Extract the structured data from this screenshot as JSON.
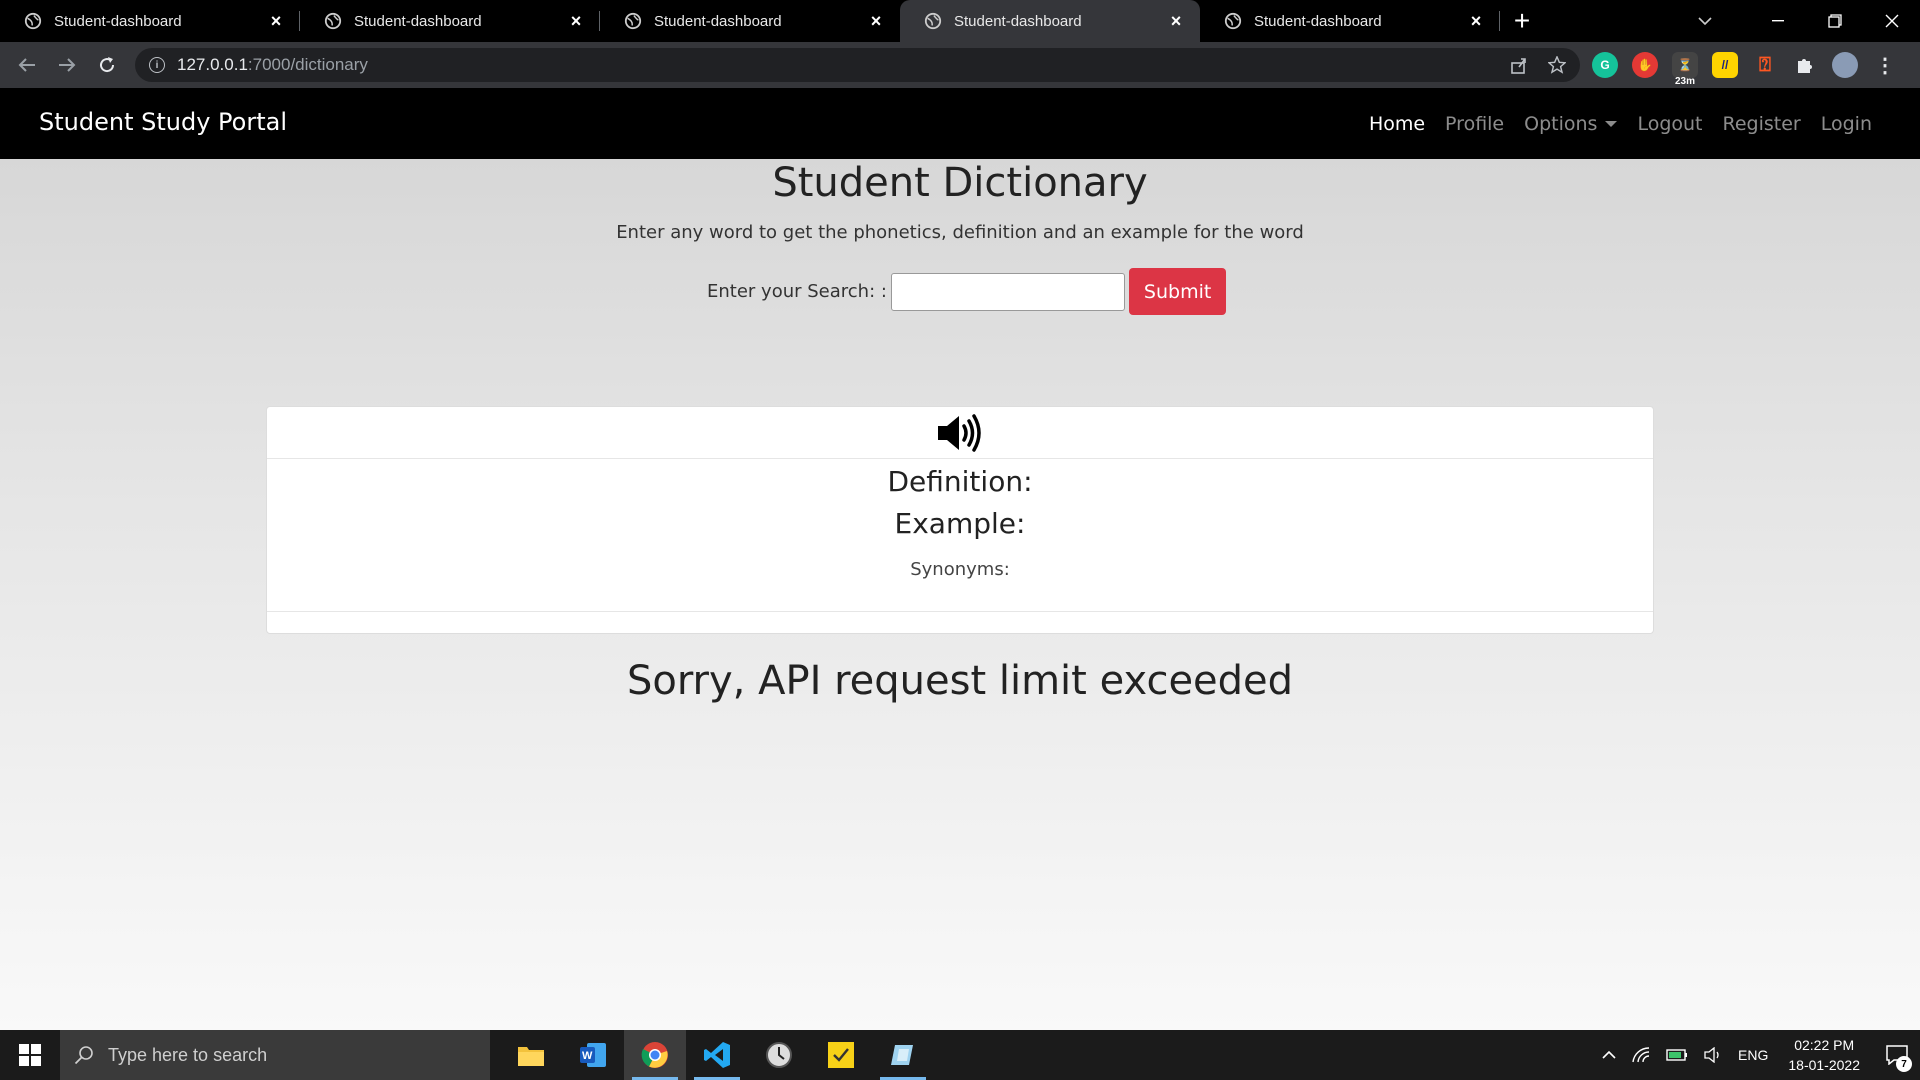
{
  "browser": {
    "tabs": [
      {
        "title": "Student-dashboard",
        "active": false
      },
      {
        "title": "Student-dashboard",
        "active": false
      },
      {
        "title": "Student-dashboard",
        "active": false
      },
      {
        "title": "Student-dashboard",
        "active": true
      },
      {
        "title": "Student-dashboard",
        "active": false
      }
    ],
    "url_host": "127.0.0.1",
    "url_path": ":7000/dictionary",
    "extension_badge": "23m"
  },
  "navbar": {
    "brand": "Student Study Portal",
    "links": {
      "home": "Home",
      "profile": "Profile",
      "options": "Options",
      "logout": "Logout",
      "register": "Register",
      "login": "Login"
    }
  },
  "main": {
    "title": "Student Dictionary",
    "subtitle": "Enter any word to get the phonetics, definition and an example for the word",
    "search_label": "Enter your Search: :",
    "search_value": "",
    "submit_label": "Submit",
    "card": {
      "definition_label": "Definition:",
      "example_label": "Example:",
      "synonyms_label": "Synonyms:"
    },
    "error_message": "Sorry, API request limit exceeded"
  },
  "taskbar": {
    "search_placeholder": "Type here to search",
    "language": "ENG",
    "time": "02:22 PM",
    "date": "18-01-2022",
    "notification_count": "7"
  },
  "colors": {
    "submit": "#dc3545",
    "navbar": "#000000",
    "accent_underline": "#76b9ed"
  }
}
